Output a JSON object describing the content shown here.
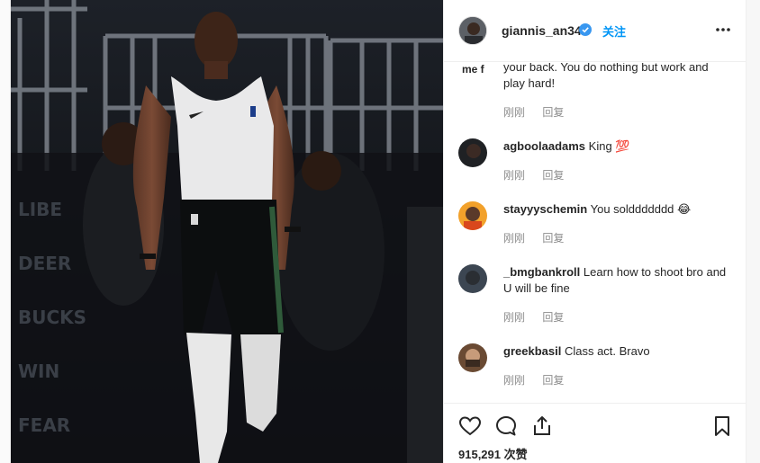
{
  "post": {
    "username": "giannis_an34",
    "follow_label": "关注",
    "likes_text": "915,291 次赞"
  },
  "comments": [
    {
      "user": "me f",
      "text": "your back. You do nothing but work and play hard!",
      "time": "刚刚",
      "reply": "回复",
      "cut": true
    },
    {
      "user": "agboolaadams",
      "text": "King 💯",
      "time": "刚刚",
      "reply": "回复"
    },
    {
      "user": "stayyyschemin",
      "text": "You solddddddd 😂",
      "time": "刚刚",
      "reply": "回复"
    },
    {
      "user": "_bmgbankroll",
      "text": "Learn how to shoot bro and U will be fine",
      "time": "刚刚",
      "reply": "回复"
    },
    {
      "user": "greekbasil",
      "text": "Class act. Bravo",
      "time": "刚刚",
      "reply": "回复"
    }
  ],
  "icons": {
    "verified": "verified-badge-icon",
    "more": "more-options-icon",
    "like": "heart-icon",
    "comment": "comment-icon",
    "share": "share-icon",
    "save": "bookmark-icon"
  },
  "colors": {
    "accent": "#0095f6",
    "muted": "#8e8e8e",
    "text": "#262626"
  }
}
